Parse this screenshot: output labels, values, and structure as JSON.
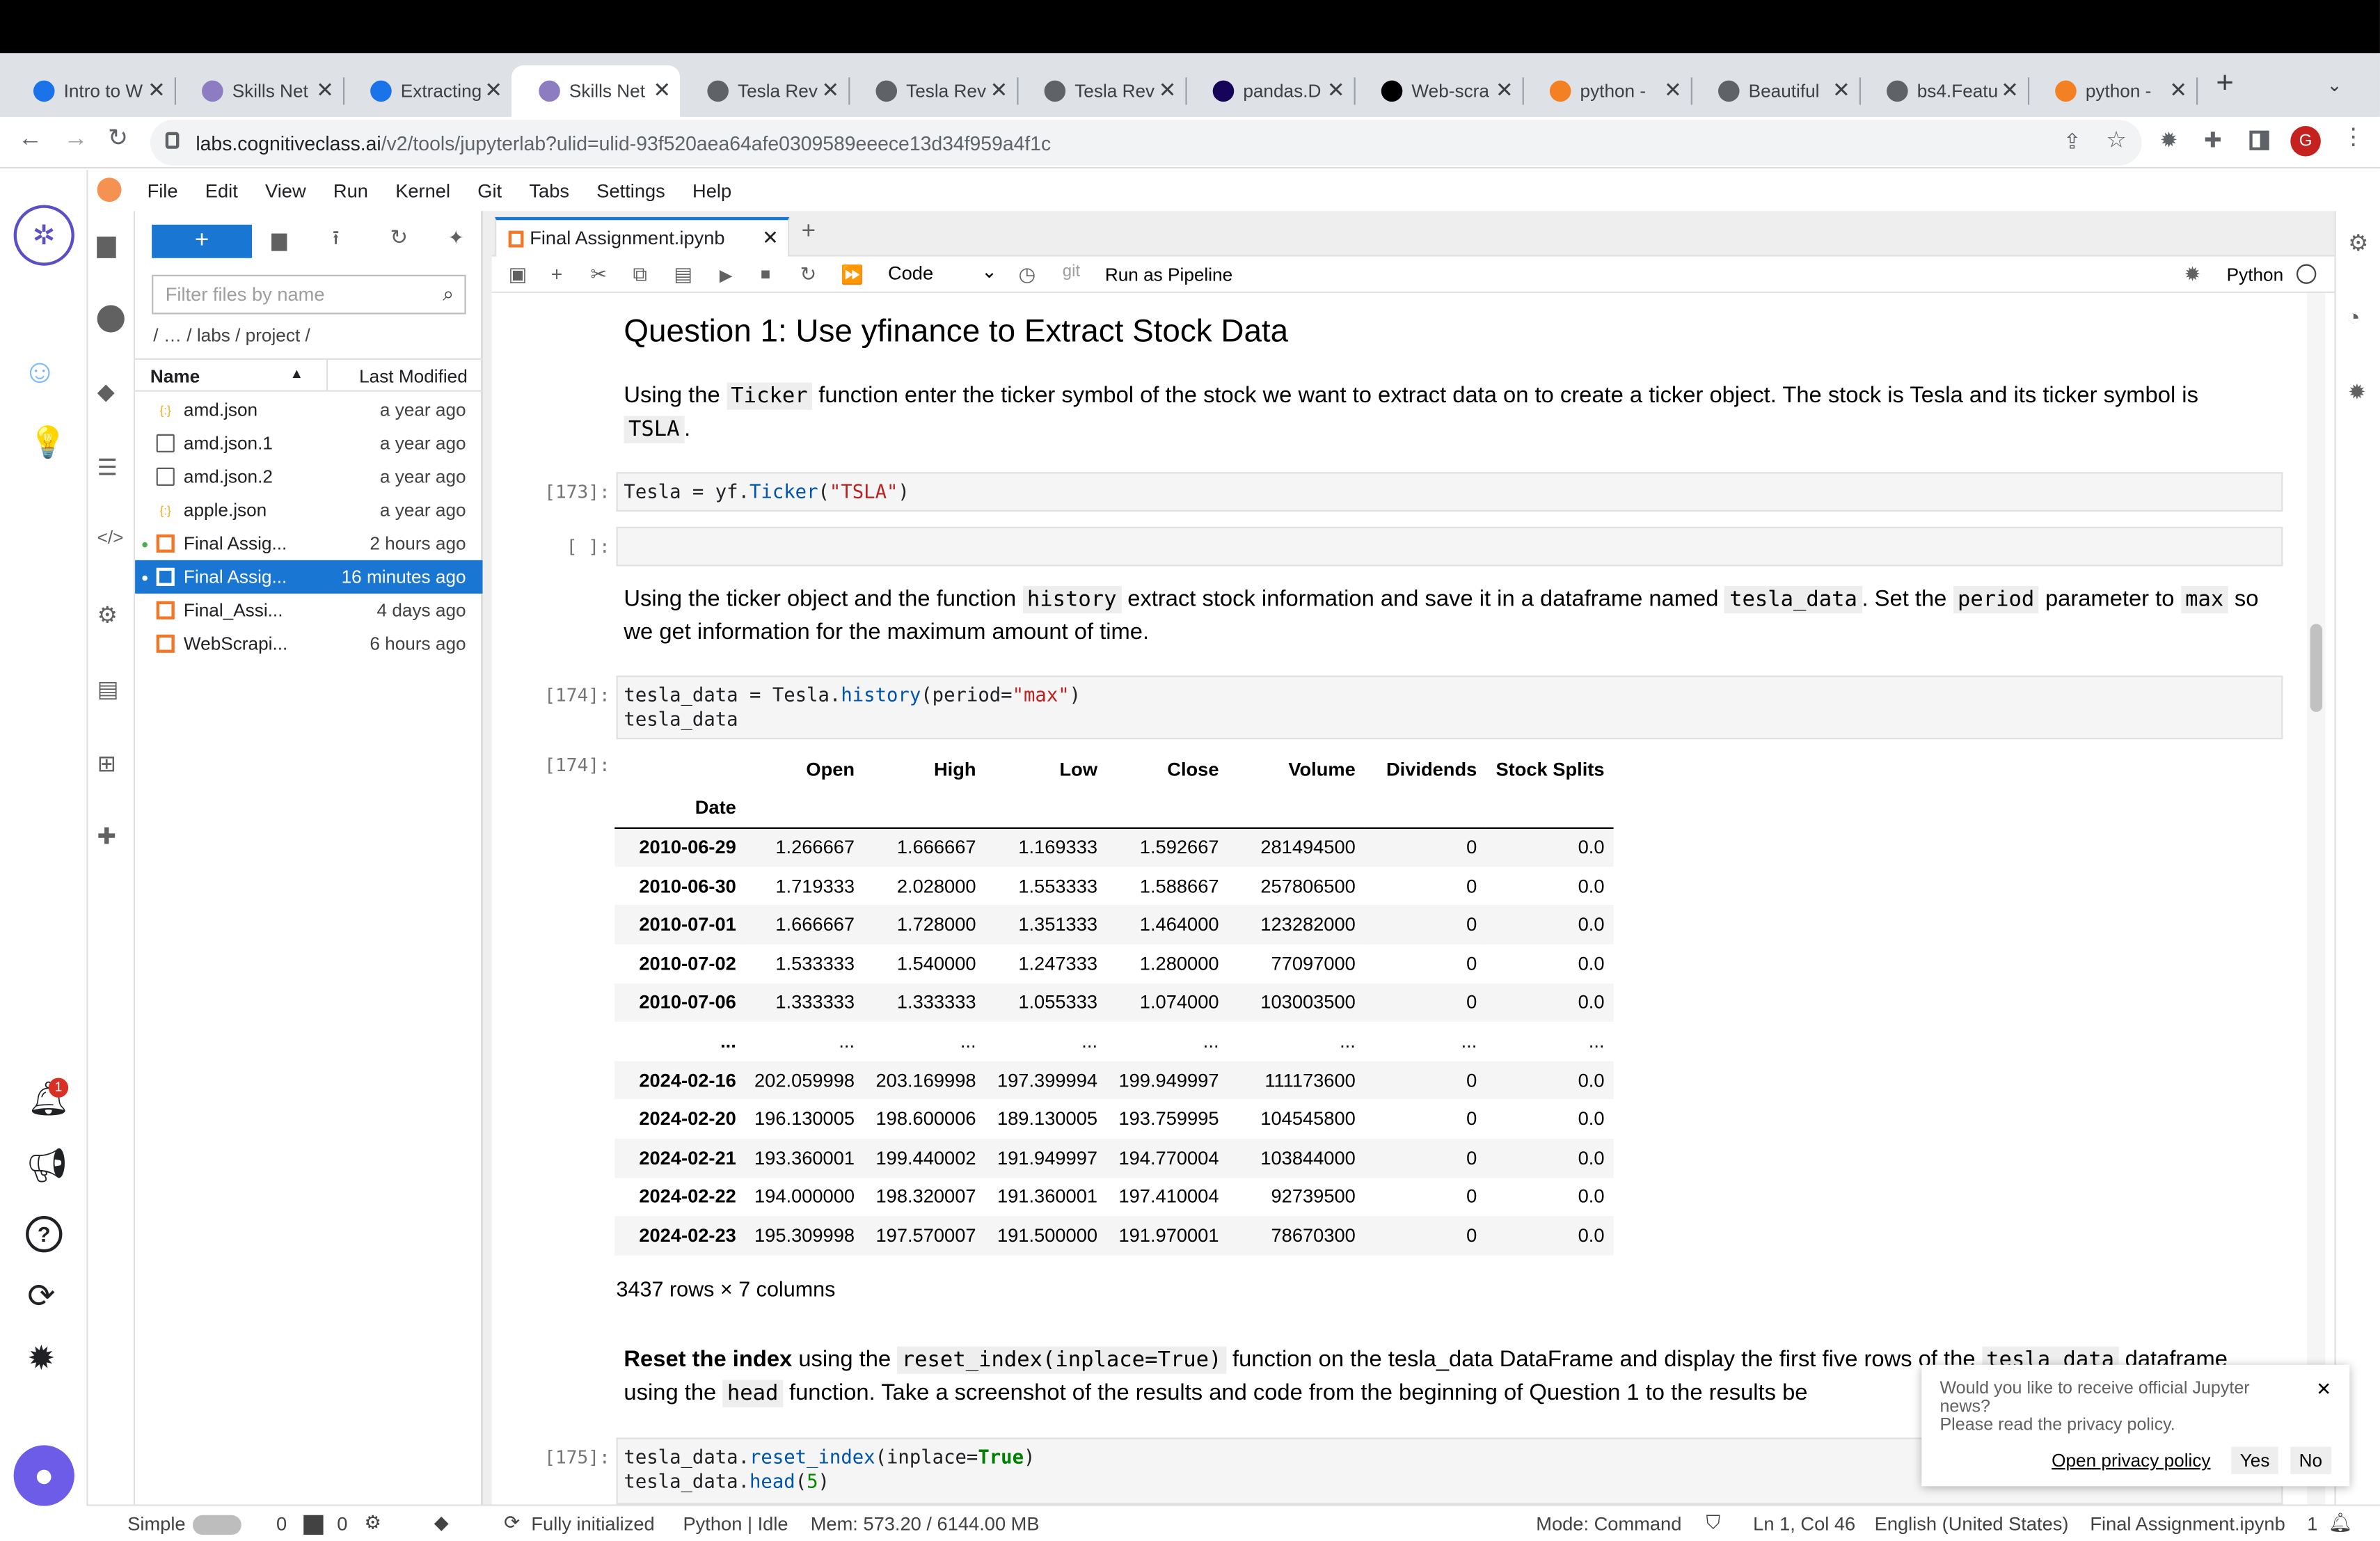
{
  "browser": {
    "tabs": [
      {
        "title": "Intro to W",
        "icon": "cognitiveclass-icon",
        "color": "#1a73e8"
      },
      {
        "title": "Skills Net",
        "icon": "skillsnetwork-icon",
        "color": "#8e7cc3"
      },
      {
        "title": "Extracting",
        "icon": "cognitiveclass-icon",
        "color": "#1a73e8"
      },
      {
        "title": "Skills Net",
        "icon": "skillsnetwork-icon",
        "color": "#8e7cc3"
      },
      {
        "title": "Tesla Rev",
        "icon": "globe-icon",
        "color": "#5f6368"
      },
      {
        "title": "Tesla Rev",
        "icon": "globe-icon",
        "color": "#5f6368"
      },
      {
        "title": "Tesla Rev",
        "icon": "globe-icon",
        "color": "#5f6368"
      },
      {
        "title": "pandas.D",
        "icon": "pandas-icon",
        "color": "#150458"
      },
      {
        "title": "Web-scra",
        "icon": "medium-icon",
        "color": "#000000"
      },
      {
        "title": "python -",
        "icon": "stackoverflow-icon",
        "color": "#f48024"
      },
      {
        "title": "Beautiful",
        "icon": "doc-icon",
        "color": "#5f6368"
      },
      {
        "title": "bs4.Featu",
        "icon": "bs4-icon",
        "color": "#5f6368"
      },
      {
        "title": "python -",
        "icon": "stackoverflow-icon",
        "color": "#f48024"
      }
    ],
    "active_tab": 3,
    "url_host": "labs.cognitiveclass.ai",
    "url_path": "/v2/tools/jupyterlab?ulid=ulid-93f520aea64afe0309589eeece13d34f959a4f1c",
    "profile_initial": "G"
  },
  "menu": [
    "File",
    "Edit",
    "View",
    "Run",
    "Kernel",
    "Git",
    "Tabs",
    "Settings",
    "Help"
  ],
  "filebrowser": {
    "new_label": "+",
    "filter_placeholder": "Filter files by name",
    "breadcrumb": "/ … / labs / project /",
    "col_name": "Name",
    "col_modified": "Last Modified",
    "files": [
      {
        "name": "amd.json",
        "modified": "a year ago",
        "type": "json",
        "running": false,
        "selected": false
      },
      {
        "name": "amd.json.1",
        "modified": "a year ago",
        "type": "file",
        "running": false,
        "selected": false
      },
      {
        "name": "amd.json.2",
        "modified": "a year ago",
        "type": "file",
        "running": false,
        "selected": false
      },
      {
        "name": "apple.json",
        "modified": "a year ago",
        "type": "json",
        "running": false,
        "selected": false
      },
      {
        "name": "Final Assig...",
        "modified": "2 hours ago",
        "type": "notebook",
        "running": true,
        "selected": false
      },
      {
        "name": "Final Assig...",
        "modified": "16 minutes ago",
        "type": "notebook",
        "running": true,
        "selected": true
      },
      {
        "name": "Final_Assi...",
        "modified": "4 days ago",
        "type": "notebook",
        "running": false,
        "selected": false
      },
      {
        "name": "WebScrapi...",
        "modified": "6 hours ago",
        "type": "notebook",
        "running": false,
        "selected": false
      }
    ]
  },
  "notebook": {
    "tab_title": "Final Assignment.ipynb",
    "cell_type": "Code",
    "git_label": "git",
    "pipeline_label": "Run as Pipeline",
    "kernel": "Python",
    "heading": "Question 1: Use yfinance to Extract Stock Data",
    "p1_a": "Using the ",
    "p1_code": "Ticker",
    "p1_b": " function enter the ticker symbol of the stock we want to extract data on to create a ticker object. The stock is Tesla and its ticker symbol is ",
    "p1_code2": "TSLA",
    "p1_c": ".",
    "prompt173": "[173]:",
    "prompt_empty": "[ ]:",
    "prompt174": "[174]:",
    "prompt175": "[175]:",
    "p2_a": "Using the ticker object and the function ",
    "p2_c1": "history",
    "p2_b": " extract stock information and save it in a dataframe named ",
    "p2_c2": "tesla_data",
    "p2_c": ". Set the ",
    "p2_c3": "period",
    "p2_d": " parameter to ",
    "p2_c4": "max",
    "p2_e": " so we get information for the maximum amount of time.",
    "p3_bold": "Reset the index",
    "p3_a": " using the ",
    "p3_c1": "reset_index(inplace=True)",
    "p3_b": " function on the tesla_data DataFrame and display the first five rows of the ",
    "p3_c2": "tesla_data",
    "p3_c": " dataframe using the ",
    "p3_c3": "head",
    "p3_d": " function. Take a screenshot of the results and code from the beginning of Question 1 to the results be",
    "df_shape": "3437 rows × 7 columns"
  },
  "table": {
    "columns": [
      "Open",
      "High",
      "Low",
      "Close",
      "Volume",
      "Dividends",
      "Stock Splits"
    ],
    "index_name": "Date",
    "rows": [
      [
        "2010-06-29",
        "1.266667",
        "1.666667",
        "1.169333",
        "1.592667",
        "281494500",
        "0",
        "0.0"
      ],
      [
        "2010-06-30",
        "1.719333",
        "2.028000",
        "1.553333",
        "1.588667",
        "257806500",
        "0",
        "0.0"
      ],
      [
        "2010-07-01",
        "1.666667",
        "1.728000",
        "1.351333",
        "1.464000",
        "123282000",
        "0",
        "0.0"
      ],
      [
        "2010-07-02",
        "1.533333",
        "1.540000",
        "1.247333",
        "1.280000",
        "77097000",
        "0",
        "0.0"
      ],
      [
        "2010-07-06",
        "1.333333",
        "1.333333",
        "1.055333",
        "1.074000",
        "103003500",
        "0",
        "0.0"
      ],
      [
        "...",
        "...",
        "...",
        "...",
        "...",
        "...",
        "...",
        "..."
      ],
      [
        "2024-02-16",
        "202.059998",
        "203.169998",
        "197.399994",
        "199.949997",
        "111173600",
        "0",
        "0.0"
      ],
      [
        "2024-02-20",
        "196.130005",
        "198.600006",
        "189.130005",
        "193.759995",
        "104545800",
        "0",
        "0.0"
      ],
      [
        "2024-02-21",
        "193.360001",
        "199.440002",
        "191.949997",
        "194.770004",
        "103844000",
        "0",
        "0.0"
      ],
      [
        "2024-02-22",
        "194.000000",
        "198.320007",
        "191.360001",
        "197.410004",
        "92739500",
        "0",
        "0.0"
      ],
      [
        "2024-02-23",
        "195.309998",
        "197.570007",
        "191.500000",
        "191.970001",
        "78670300",
        "0",
        "0.0"
      ]
    ]
  },
  "toast": {
    "line1": "Would you like to receive official Jupyter news?",
    "line2": "Please read the privacy policy.",
    "link": "Open privacy policy",
    "yes": "Yes",
    "no": "No"
  },
  "status": {
    "mode_toggle": "Simple",
    "terminals": "0",
    "kernels": "0",
    "init": "Fully initialized",
    "kernel": "Python | Idle",
    "mem": "Mem: 573.20 / 6144.00 MB",
    "cmd": "Mode: Command",
    "pos": "Ln 1, Col 46",
    "lang": "English (United States)",
    "file": "Final Assignment.ipynb",
    "count": "1"
  },
  "notifications": {
    "badge": "1"
  }
}
